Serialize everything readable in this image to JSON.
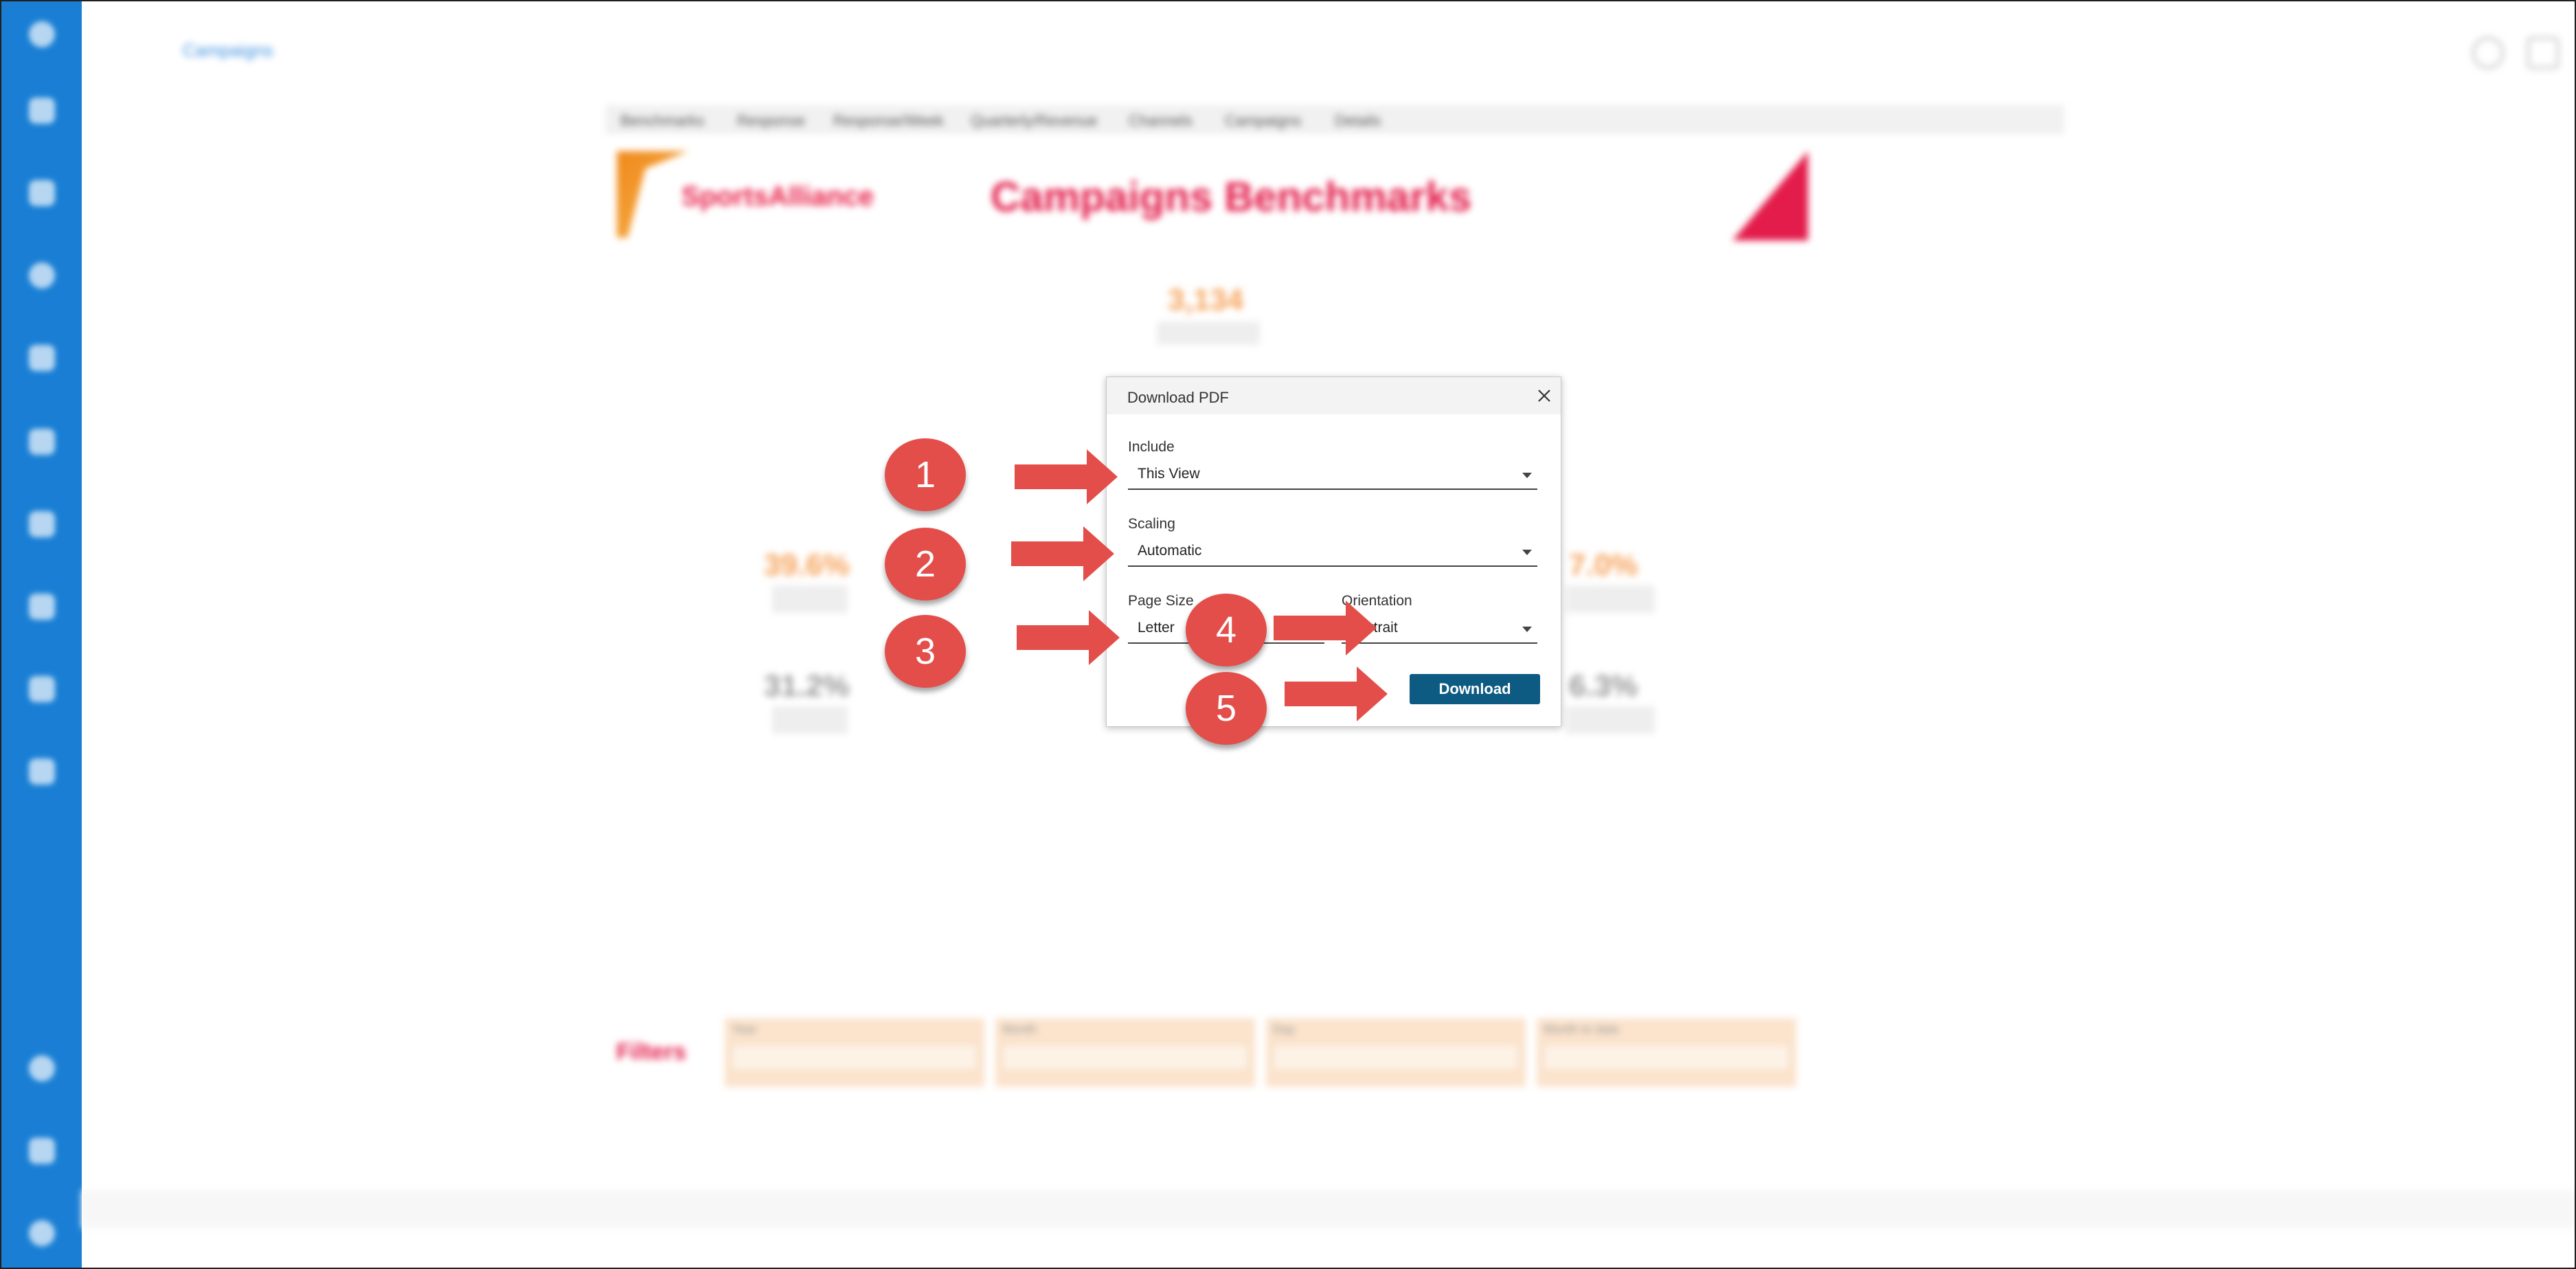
{
  "app": {
    "breadcrumb": "Campaigns",
    "tabs": [
      "Benchmarks",
      "Response",
      "Response/Week",
      "Quarterly/Revenue",
      "Channels",
      "Campaigns",
      "Details"
    ]
  },
  "dashboard": {
    "logo_text": "SportsAlliance",
    "title": "Campaigns Benchmarks",
    "kpis": [
      {
        "value": "3,134",
        "color": "#f5a25a"
      },
      {
        "value": "39.6%",
        "color": "#f5a25a"
      },
      {
        "value": "7.0%",
        "color": "#f5a25a"
      },
      {
        "value": "31.2%",
        "color": "#9a9a9a"
      },
      {
        "value": "6.3%",
        "color": "#9a9a9a"
      }
    ],
    "filters_label": "Filters",
    "filters": [
      "Year",
      "Month",
      "Day",
      "Month to date"
    ]
  },
  "dialog": {
    "title": "Download PDF",
    "include": {
      "label": "Include",
      "value": "This View"
    },
    "scaling": {
      "label": "Scaling",
      "value": "Automatic"
    },
    "page_size": {
      "label": "Page Size",
      "value": "Letter"
    },
    "orientation": {
      "label": "Orientation",
      "value": "Portrait"
    },
    "download_label": "Download"
  },
  "callouts": [
    "1",
    "2",
    "3",
    "4",
    "5"
  ],
  "colors": {
    "rail": "#1a7fd4",
    "accent": "#e31c4b",
    "button": "#0d5a82",
    "callout": "#e34e4a"
  }
}
